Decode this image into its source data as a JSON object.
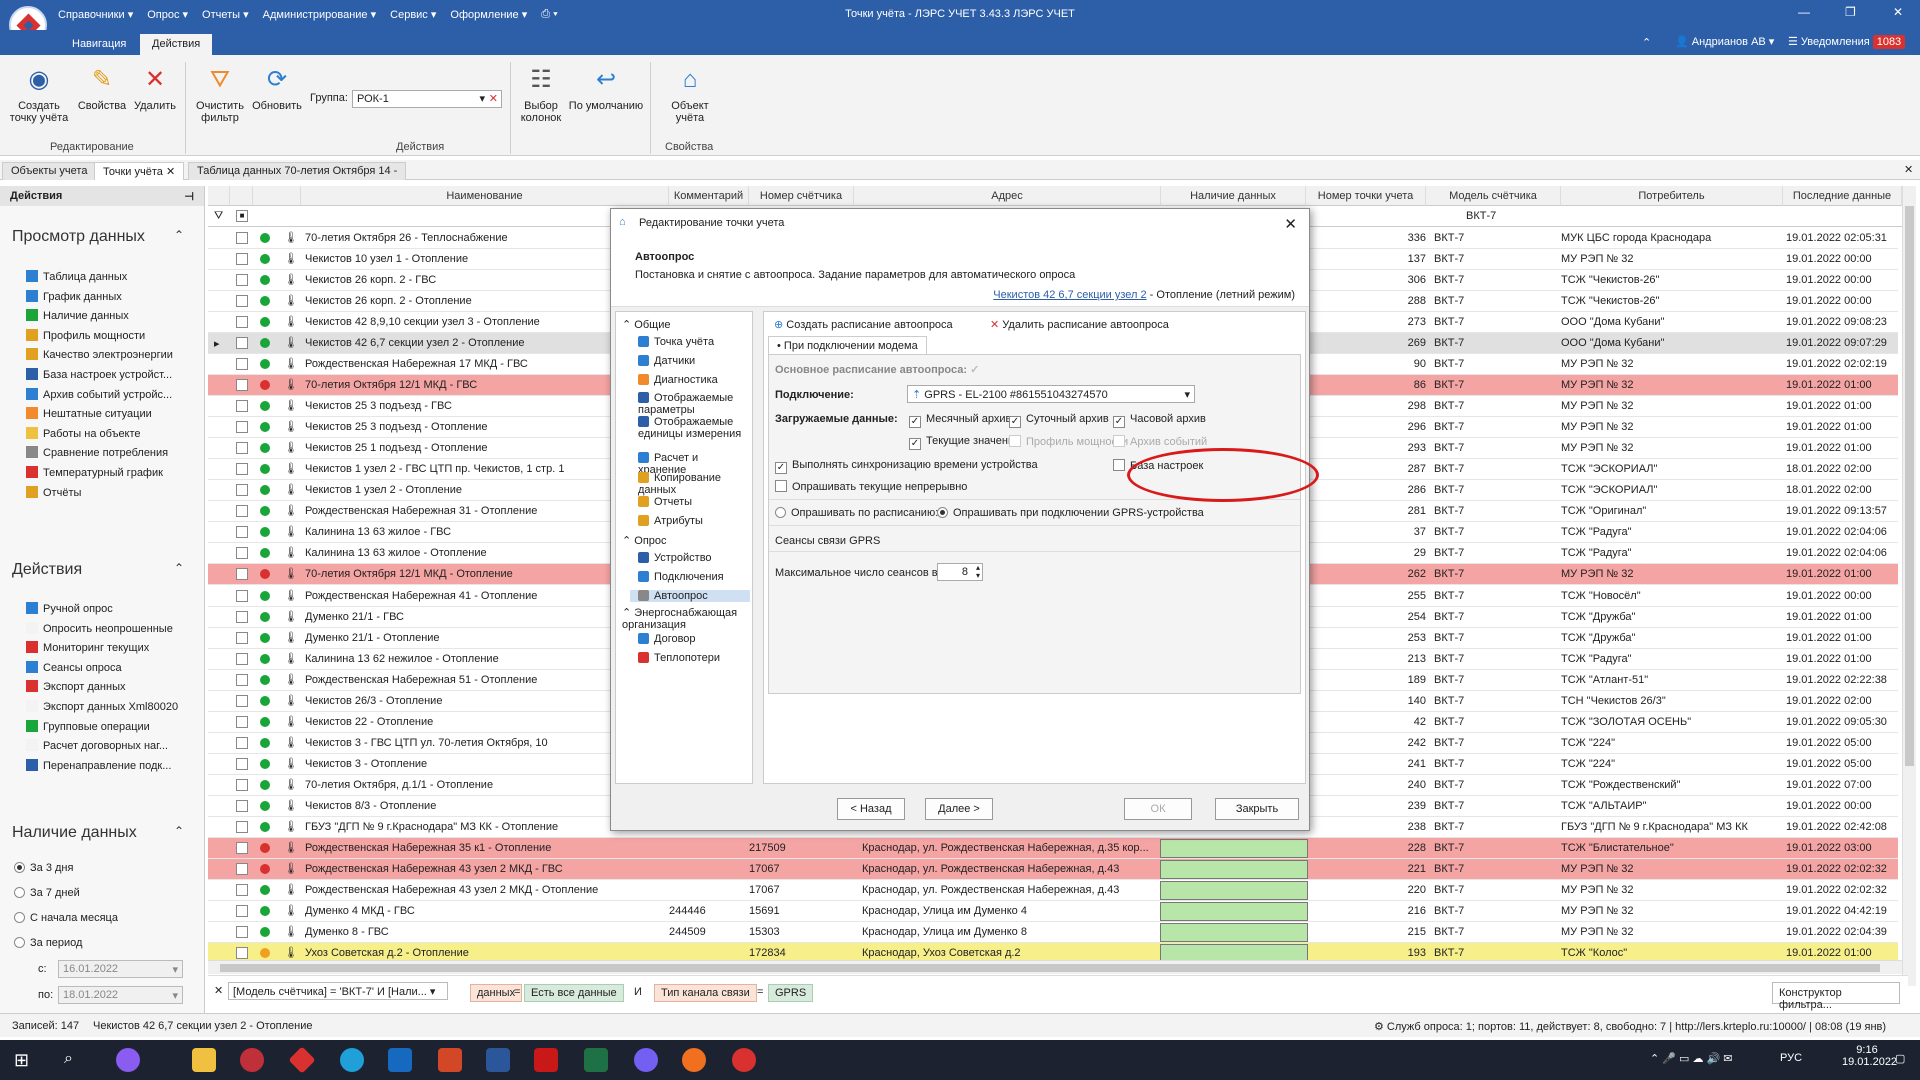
{
  "app": {
    "title": "Точки учёта - ЛЭРС УЧЕТ 3.43.3 ЛЭРС УЧЕТ",
    "menu": [
      "Справочники ▾",
      "Опрос ▾",
      "Отчеты ▾",
      "Администрирование ▾",
      "Сервис ▾",
      "Оформление ▾"
    ],
    "ribbon_tabs": [
      "Навигация",
      "Действия"
    ],
    "user": "Андрианов АВ ▾",
    "notifications_label": "Уведомления",
    "notifications_count": "1083"
  },
  "ribbon": {
    "create": "Создать точку учёта",
    "properties": "Свойства",
    "delete": "Удалить",
    "clear_filter": "Очистить фильтр",
    "refresh": "Обновить",
    "group_label": "Группа:",
    "group_value": "РОК-1",
    "columns": "Выбор колонок",
    "default": "По умолчанию",
    "object": "Объект учёта",
    "grp_edit": "Редактирование",
    "grp_actions": "Действия",
    "grp_props": "Свойства"
  },
  "doc_tabs": [
    "Объекты учета",
    "Точки учёта",
    "Таблица данных 70-летия Октября 14 -"
  ],
  "left": {
    "actions_header": "Действия",
    "view_header": "Просмотр данных",
    "view_items": [
      "Таблица данных",
      "График данных",
      "Наличие данных",
      "Профиль мощности",
      "Качество электроэнергии",
      "База настроек устройст...",
      "Архив событий устройс...",
      "Нештатные ситуации",
      "Работы на объекте",
      "Сравнение потребления",
      "Температурный график",
      "Отчёты"
    ],
    "actions2_header": "Действия",
    "action_items": [
      "Ручной опрос",
      "Опросить неопрошенные",
      "Мониторинг текущих",
      "Сеансы опроса",
      "Экспорт данных",
      "Экспорт данных Xml80020",
      "Групповые операции",
      "Расчет договорных наг...",
      "Перенаправление подк..."
    ],
    "avail_header": "Наличие данных",
    "avail_items": [
      "За 3 дня",
      "За 7 дней",
      "С начала месяца",
      "За период"
    ],
    "from_label": "с:",
    "from_value": "16.01.2022",
    "to_label": "по:",
    "to_value": "18.01.2022"
  },
  "grid": {
    "columns": [
      "Наименование",
      "Комментарий",
      "Номер счётчика",
      "Адрес",
      "Наличие данных",
      "Номер точки учета",
      "Модель счётчика",
      "Потребитель",
      "Последние данные"
    ],
    "filter_model": "ВКТ-7",
    "rows": [
      {
        "name": "70-летия Октября 26 - Теплоснабжение",
        "comment": "",
        "meter": "",
        "addr": "",
        "num": "336",
        "model": "ВКТ-7",
        "consumer": "МУК ЦБС города Краснодара",
        "last": "19.01.2022 02:05:31",
        "style": "",
        "dot": "g"
      },
      {
        "name": "Чекистов 10 узел 1 - Отопление",
        "comment": "",
        "meter": "",
        "addr": "",
        "num": "137",
        "model": "ВКТ-7",
        "consumer": "МУ РЭП № 32",
        "last": "19.01.2022 00:00",
        "style": "",
        "dot": "g"
      },
      {
        "name": "Чекистов 26 корп. 2 - ГВС",
        "comment": "",
        "meter": "",
        "addr": "",
        "num": "306",
        "model": "ВКТ-7",
        "consumer": "ТСЖ \"Чекистов-26\"",
        "last": "19.01.2022 00:00",
        "style": "",
        "dot": "g"
      },
      {
        "name": "Чекистов 26 корп. 2 - Отопление",
        "comment": "",
        "meter": "",
        "addr": "",
        "num": "288",
        "model": "ВКТ-7",
        "consumer": "ТСЖ \"Чекистов-26\"",
        "last": "19.01.2022 00:00",
        "style": "",
        "dot": "g"
      },
      {
        "name": "Чекистов 42 8,9,10 секции узел 3 - Отопление",
        "comment": "",
        "meter": "",
        "addr": "",
        "num": "273",
        "model": "ВКТ-7",
        "consumer": "ООО \"Дома Кубани\"",
        "last": "19.01.2022 09:08:23",
        "style": "",
        "dot": "g"
      },
      {
        "name": "Чекистов 42 6,7 секции узел 2 - Отопление",
        "comment": "",
        "meter": "",
        "addr": "",
        "num": "269",
        "model": "ВКТ-7",
        "consumer": "ООО \"Дома Кубани\"",
        "last": "19.01.2022 09:07:29",
        "style": "sel",
        "dot": "g"
      },
      {
        "name": "Рождественская Набережная 17 МКД - ГВС",
        "comment": "",
        "meter": "",
        "addr": "",
        "num": "90",
        "model": "ВКТ-7",
        "consumer": "МУ РЭП № 32",
        "last": "19.01.2022 02:02:19",
        "style": "",
        "dot": "g"
      },
      {
        "name": "70-летия Октября 12/1 МКД - ГВС",
        "comment": "",
        "meter": "",
        "addr": "",
        "num": "86",
        "model": "ВКТ-7",
        "consumer": "МУ РЭП № 32",
        "last": "19.01.2022 01:00",
        "style": "red",
        "dot": "r"
      },
      {
        "name": "Чекистов 25 3 подъезд - ГВС",
        "comment": "",
        "meter": "",
        "addr": "",
        "num": "298",
        "model": "ВКТ-7",
        "consumer": "МУ РЭП № 32",
        "last": "19.01.2022 01:00",
        "style": "",
        "dot": "g"
      },
      {
        "name": "Чекистов 25 3 подъезд - Отопление",
        "comment": "",
        "meter": "",
        "addr": "",
        "num": "296",
        "model": "ВКТ-7",
        "consumer": "МУ РЭП № 32",
        "last": "19.01.2022 01:00",
        "style": "",
        "dot": "g"
      },
      {
        "name": "Чекистов 25 1 подъезд - Отопление",
        "comment": "",
        "meter": "",
        "addr": "",
        "num": "293",
        "model": "ВКТ-7",
        "consumer": "МУ РЭП № 32",
        "last": "19.01.2022 01:00",
        "style": "",
        "dot": "g"
      },
      {
        "name": "Чекистов 1 узел 2 - ГВС ЦТП пр. Чекистов, 1 стр. 1",
        "comment": "",
        "meter": "",
        "addr": "",
        "num": "287",
        "model": "ВКТ-7",
        "consumer": "ТСЖ \"ЭСКОРИАЛ\"",
        "last": "18.01.2022 02:00",
        "style": "",
        "dot": "g"
      },
      {
        "name": "Чекистов 1 узел 2 - Отопление",
        "comment": "",
        "meter": "",
        "addr": "",
        "num": "286",
        "model": "ВКТ-7",
        "consumer": "ТСЖ \"ЭСКОРИАЛ\"",
        "last": "18.01.2022 02:00",
        "style": "",
        "dot": "g"
      },
      {
        "name": "Рождественская Набережная 31 - Отопление",
        "comment": "",
        "meter": "",
        "addr": "",
        "num": "281",
        "model": "ВКТ-7",
        "consumer": "ТСЖ \"Оригинал\"",
        "last": "19.01.2022 09:13:57",
        "style": "",
        "dot": "g"
      },
      {
        "name": "Калинина 13 63 жилое - ГВС",
        "comment": "",
        "meter": "",
        "addr": "",
        "num": "37",
        "model": "ВКТ-7",
        "consumer": "ТСЖ \"Радуга\"",
        "last": "19.01.2022 02:04:06",
        "style": "",
        "dot": "g"
      },
      {
        "name": "Калинина 13 63 жилое - Отопление",
        "comment": "",
        "meter": "",
        "addr": "",
        "num": "29",
        "model": "ВКТ-7",
        "consumer": "ТСЖ \"Радуга\"",
        "last": "19.01.2022 02:04:06",
        "style": "",
        "dot": "g"
      },
      {
        "name": "70-летия Октября 12/1 МКД - Отопление",
        "comment": "",
        "meter": "",
        "addr": "",
        "num": "262",
        "model": "ВКТ-7",
        "consumer": "МУ РЭП № 32",
        "last": "19.01.2022 01:00",
        "style": "red",
        "dot": "r"
      },
      {
        "name": "Рождественская Набережная 41 - Отопление",
        "comment": "",
        "meter": "",
        "addr": "",
        "num": "255",
        "model": "ВКТ-7",
        "consumer": "ТСЖ \"Новосёл\"",
        "last": "19.01.2022 00:00",
        "style": "",
        "dot": "g"
      },
      {
        "name": "Думенко 21/1 - ГВС",
        "comment": "",
        "meter": "",
        "addr": "",
        "num": "254",
        "model": "ВКТ-7",
        "consumer": "ТСЖ \"Дружба\"",
        "last": "19.01.2022 01:00",
        "style": "",
        "dot": "g"
      },
      {
        "name": "Думенко 21/1 - Отопление",
        "comment": "",
        "meter": "",
        "addr": "",
        "num": "253",
        "model": "ВКТ-7",
        "consumer": "ТСЖ \"Дружба\"",
        "last": "19.01.2022 01:00",
        "style": "",
        "dot": "g"
      },
      {
        "name": "Калинина 13 62 нежилое - Отопление",
        "comment": "",
        "meter": "",
        "addr": "",
        "num": "213",
        "model": "ВКТ-7",
        "consumer": "ТСЖ \"Радуга\"",
        "last": "19.01.2022 01:00",
        "style": "",
        "dot": "g"
      },
      {
        "name": "Рождественская Набережная 51 - Отопление",
        "comment": "",
        "meter": "",
        "addr": "",
        "num": "189",
        "model": "ВКТ-7",
        "consumer": "ТСЖ \"Атлант-51\"",
        "last": "19.01.2022 02:22:38",
        "style": "",
        "dot": "g"
      },
      {
        "name": "Чекистов 26/3 - Отопление",
        "comment": "",
        "meter": "",
        "addr": "",
        "num": "140",
        "model": "ВКТ-7",
        "consumer": "ТСН \"Чекистов 26/3\"",
        "last": "19.01.2022 02:00",
        "style": "",
        "dot": "g"
      },
      {
        "name": "Чекистов 22 - Отопление",
        "comment": "",
        "meter": "",
        "addr": "",
        "num": "42",
        "model": "ВКТ-7",
        "consumer": "ТСЖ \"ЗОЛОТАЯ ОСЕНЬ\"",
        "last": "19.01.2022 09:05:30",
        "style": "",
        "dot": "g"
      },
      {
        "name": "Чекистов 3 - ГВС ЦТП ул. 70-летия Октября, 10",
        "comment": "",
        "meter": "",
        "addr": "",
        "num": "242",
        "model": "ВКТ-7",
        "consumer": "ТСЖ \"224\"",
        "last": "19.01.2022 05:00",
        "style": "",
        "dot": "g"
      },
      {
        "name": "Чекистов 3 - Отопление",
        "comment": "",
        "meter": "",
        "addr": "",
        "num": "241",
        "model": "ВКТ-7",
        "consumer": "ТСЖ \"224\"",
        "last": "19.01.2022 05:00",
        "style": "",
        "dot": "g"
      },
      {
        "name": "70-летия Октября, д.1/1 - Отопление",
        "comment": "",
        "meter": "",
        "addr": "",
        "num": "240",
        "model": "ВКТ-7",
        "consumer": "ТСЖ \"Рождественский\"",
        "last": "19.01.2022 07:00",
        "style": "",
        "dot": "g"
      },
      {
        "name": "Чекистов 8/3 - Отопление",
        "comment": "",
        "meter": "",
        "addr": "",
        "num": "239",
        "model": "ВКТ-7",
        "consumer": "ТСЖ \"АЛЬТАИР\"",
        "last": "19.01.2022 00:00",
        "style": "",
        "dot": "g"
      },
      {
        "name": "ГБУЗ \"ДГП № 9 г.Краснодара\" МЗ КК - Отопление",
        "comment": "",
        "meter": "",
        "addr": "",
        "num": "238",
        "model": "ВКТ-7",
        "consumer": "ГБУЗ \"ДГП № 9 г.Краснодара\" МЗ КК",
        "last": "19.01.2022 02:42:08",
        "style": "",
        "dot": "g"
      },
      {
        "name": "Рождественская Набережная 35 к1 - Отопление",
        "comment": "",
        "meter": "217509",
        "addr": "Краснодар, ул. Рождественская Набережная, д.35 кор...",
        "num": "228",
        "model": "ВКТ-7",
        "consumer": "ТСЖ \"Блистательное\"",
        "last": "19.01.2022 03:00",
        "style": "red",
        "dot": "r"
      },
      {
        "name": "Рождественская Набережная 43 узел 2 МКД - ГВС",
        "comment": "",
        "meter": "17067",
        "addr": "Краснодар, ул. Рождественская Набережная, д.43",
        "num": "221",
        "model": "ВКТ-7",
        "consumer": "МУ РЭП № 32",
        "last": "19.01.2022 02:02:32",
        "style": "red",
        "dot": "r"
      },
      {
        "name": "Рождественская Набережная 43 узел 2 МКД - Отопление",
        "comment": "",
        "meter": "17067",
        "addr": "Краснодар, ул. Рождественская Набережная, д.43",
        "num": "220",
        "model": "ВКТ-7",
        "consumer": "МУ РЭП № 32",
        "last": "19.01.2022 02:02:32",
        "style": "",
        "dot": "g"
      },
      {
        "name": "Думенко 4 МКД - ГВС",
        "comment": "244446",
        "meter": "15691",
        "addr": "Краснодар, Улица им Думенко 4",
        "num": "216",
        "model": "ВКТ-7",
        "consumer": "МУ РЭП № 32",
        "last": "19.01.2022 04:42:19",
        "style": "",
        "dot": "g"
      },
      {
        "name": "Думенко 8 - ГВС",
        "comment": "244509",
        "meter": "15303",
        "addr": "Краснодар, Улица им Думенко 8",
        "num": "215",
        "model": "ВКТ-7",
        "consumer": "МУ РЭП № 32",
        "last": "19.01.2022 02:04:39",
        "style": "",
        "dot": "g"
      },
      {
        "name": "Ухоз Советская д.2 - Отопление",
        "comment": "",
        "meter": "172834",
        "addr": "Краснодар, Ухоз Советская д.2",
        "num": "193",
        "model": "ВКТ-7",
        "consumer": "ТСЖ \"Колос\"",
        "last": "19.01.2022 01:00",
        "style": "yel",
        "dot": "o"
      }
    ]
  },
  "filterbar": {
    "expr": "[Модель счётчика] = 'ВКТ-7' И [Нали...",
    "c1": "данных",
    "eq1": "=",
    "c2": "Есть все данные",
    "and": "И",
    "c3": "Тип канала связи",
    "eq2": "=",
    "c4": "GPRS",
    "builder": "Конструктор фильтра..."
  },
  "status": {
    "records": "Записей: 147",
    "current": "Чекистов 42 6,7 секции узел 2 - Отопление",
    "right": "Служб опроса: 1; портов: 11, действует: 8, свободно: 7 | http://lers.krteplo.ru:10000/ | 08:08 (19 янв)"
  },
  "taskbar": {
    "lang": "РУС",
    "time": "9:16",
    "date": "19.01.2022"
  },
  "dialog": {
    "title": "Редактирование точки учета",
    "section": "Автоопрос",
    "desc": "Постановка и снятие с автоопроса. Задание параметров для автоматического опроса",
    "link": "Чекистов 42 6,7 секции узел 2",
    "link_suffix": " - Отопление (летний режим)",
    "nav": {
      "general": "Общие",
      "items1": [
        "Точка учёта",
        "Датчики",
        "Диагностика",
        "Отображаемые параметры",
        "Отображаемые единицы измерения",
        "Расчет и хранение",
        "Копирование данных",
        "Отчеты",
        "Атрибуты"
      ],
      "poll": "Опрос",
      "items2": [
        "Устройство",
        "Подключения",
        "Автоопрос"
      ],
      "energy": "Энергоснабжающая организация",
      "items3": [
        "Договор",
        "Теплопотери"
      ]
    },
    "toolbar_create": "Создать расписание автоопроса",
    "toolbar_delete": "Удалить расписание автоопроса",
    "subtab": "При подключении модема",
    "main_schedule": "Основное расписание автоопроса:",
    "conn_label": "Подключение:",
    "conn_value": "GPRS - EL-2100 #861551043274570",
    "load_label": "Загружаемые данные:",
    "monthly": "Месячный архив",
    "daily": "Суточный архив",
    "hourly": "Часовой архив",
    "current": "Текущие значения",
    "power": "Профиль мощности",
    "events": "Архив событий",
    "settings_base": "База настроек",
    "sync_time": "Выполнять синхронизацию времени устройства",
    "poll_continuous": "Опрашивать текущие непрерывно",
    "by_schedule": "Опрашивать по расписанию:",
    "on_connect": "Опрашивать при подключении GPRS-устройства",
    "sessions": "Сеансы связи GPRS",
    "max_sessions": "Максимальное число сеансов в сутки:",
    "max_sessions_value": "8",
    "back": "< Назад",
    "next": "Далее >",
    "ok": "ОК",
    "close": "Закрыть"
  }
}
